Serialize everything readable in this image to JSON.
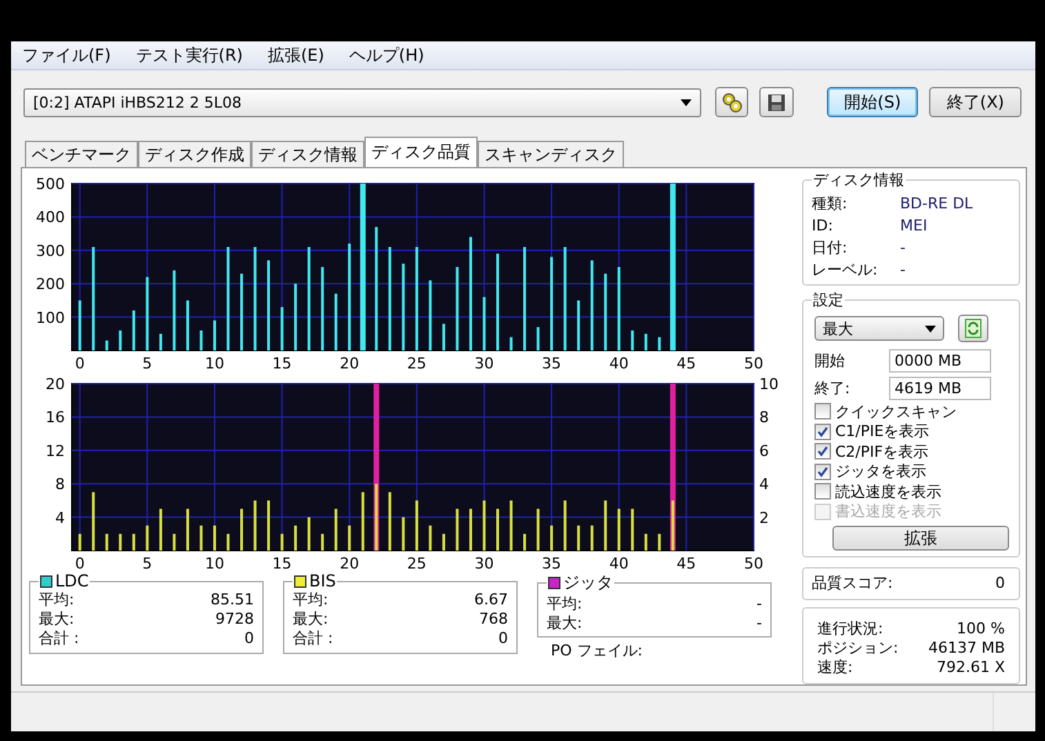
{
  "menu": [
    {
      "label": "ファイル(F)"
    },
    {
      "label": "テスト実行(R)"
    },
    {
      "label": "拡張(E)"
    },
    {
      "label": "ヘルプ(H)"
    }
  ],
  "toolbar": {
    "drive": "[0:2]   ATAPI iHBS212   2 5L08",
    "buttons": [
      {
        "label": "開始(S)",
        "focused": true
      },
      {
        "label": "終了(X)",
        "focused": false
      }
    ]
  },
  "tabs": [
    {
      "label": "ベンチマーク",
      "selected": false
    },
    {
      "label": "ディスク作成",
      "selected": false
    },
    {
      "label": "ディスク情報",
      "selected": false
    },
    {
      "label": "ディスク品質",
      "selected": true
    },
    {
      "label": "スキャンディスク",
      "selected": false
    }
  ],
  "charts": [
    {
      "chart_data": {
        "type": "bar",
        "grid": true,
        "xlim": [
          -0.6,
          50
        ],
        "ylim": [
          0,
          500
        ],
        "xticks": [
          0,
          5,
          10,
          15,
          20,
          25,
          30,
          35,
          40,
          45,
          50
        ],
        "yticks": [
          100,
          200,
          300,
          400,
          500
        ],
        "x": [
          0,
          1,
          2,
          3,
          4,
          5,
          6,
          7,
          8,
          9,
          10,
          11,
          12,
          13,
          14,
          15,
          16,
          17,
          18,
          19,
          20,
          21,
          22,
          23,
          24,
          25,
          26,
          27,
          28,
          29,
          30,
          31,
          32,
          33,
          34,
          35,
          36,
          37,
          38,
          39,
          40,
          41,
          42,
          43,
          44
        ],
        "series": [
          {
            "name": "LDC",
            "color": "#40e8f0",
            "values": [
              150,
              310,
              30,
              60,
              120,
              220,
              50,
              240,
              150,
              60,
              90,
              310,
              230,
              310,
              270,
              130,
              200,
              310,
              250,
              170,
              320,
              500,
              370,
              310,
              260,
              310,
              210,
              80,
              250,
              340,
              160,
              290,
              40,
              310,
              70,
              280,
              310,
              150,
              270,
              230,
              250,
              60,
              50,
              40,
              500
            ]
          }
        ]
      }
    },
    {
      "chart_data": {
        "type": "bar",
        "grid": true,
        "xlim": [
          -0.6,
          50
        ],
        "ylim": [
          0,
          20
        ],
        "y2lim": [
          0,
          10
        ],
        "xticks": [
          0,
          5,
          10,
          15,
          20,
          25,
          30,
          35,
          40,
          45,
          50
        ],
        "yticks": [
          4,
          8,
          12,
          16,
          20
        ],
        "y2ticks": [
          2,
          4,
          6,
          8,
          10
        ],
        "x": [
          0,
          1,
          2,
          3,
          4,
          5,
          6,
          7,
          8,
          9,
          10,
          11,
          12,
          13,
          14,
          15,
          16,
          17,
          18,
          19,
          20,
          21,
          22,
          23,
          24,
          25,
          26,
          27,
          28,
          29,
          30,
          31,
          32,
          33,
          34,
          35,
          36,
          37,
          38,
          39,
          40,
          41,
          42,
          43,
          44
        ],
        "series": [
          {
            "name": "BIS",
            "color": "#d8e040",
            "values": [
              2,
              7,
              2,
              2,
              2,
              3,
              5,
              2,
              5,
              3,
              3,
              2,
              5,
              6,
              6,
              2,
              3,
              4,
              2,
              5,
              3,
              7,
              8,
              7,
              4,
              6,
              3,
              2,
              5,
              5,
              6,
              5,
              6,
              2,
              5,
              3,
              6,
              3,
              3,
              6,
              5,
              5,
              2,
              2,
              6
            ]
          },
          {
            "name": "ジッタ",
            "color": "#e020a0",
            "values": [
              null,
              null,
              null,
              null,
              null,
              null,
              null,
              null,
              null,
              null,
              null,
              null,
              null,
              null,
              null,
              null,
              null,
              null,
              null,
              null,
              null,
              null,
              20,
              null,
              null,
              null,
              null,
              null,
              null,
              null,
              null,
              null,
              null,
              null,
              null,
              null,
              null,
              null,
              null,
              null,
              null,
              null,
              null,
              null,
              20
            ]
          }
        ]
      }
    }
  ],
  "stats": [
    {
      "color": "#33cccc",
      "rows": [
        {
          "label": "平均:",
          "value": "85.51"
        },
        {
          "label": "最大:",
          "value": "9728"
        },
        {
          "label": "合計 :",
          "value": "0"
        }
      ]
    },
    {
      "color": "#eeee33",
      "rows": [
        {
          "label": "平均:",
          "value": "6.67"
        },
        {
          "label": "最大:",
          "value": "768"
        },
        {
          "label": "合計 :",
          "value": "0"
        }
      ]
    },
    {
      "color": "#cc22cc",
      "rows": [
        {
          "label": "平均:",
          "value": "-"
        },
        {
          "label": "最大:",
          "value": "-"
        }
      ]
    }
  ],
  "po_fail": "PO フェイル:",
  "disc_info": {
    "title": "ディスク情報",
    "rows": [
      {
        "label": "種類:",
        "value": "BD-RE DL"
      },
      {
        "label": "ID:",
        "value": "MEI"
      },
      {
        "label": "日付:",
        "value": "-"
      },
      {
        "label": "レーベル:",
        "value": "-"
      }
    ]
  },
  "settings": {
    "title": "設定",
    "speed": "最大",
    "start": {
      "label": "開始",
      "value": "0000 MB"
    },
    "end": {
      "label": "終了:",
      "value": "4619 MB"
    },
    "options": [
      {
        "label": "クイックスキャン",
        "checked": false,
        "disabled": false
      },
      {
        "label": "C1/PIEを表示",
        "checked": true,
        "disabled": false
      },
      {
        "label": "C2/PIFを表示",
        "checked": true,
        "disabled": false
      },
      {
        "label": "ジッタを表示",
        "checked": true,
        "disabled": false
      },
      {
        "label": "読込速度を表示",
        "checked": false,
        "disabled": false
      },
      {
        "label": "書込速度を表示",
        "checked": false,
        "disabled": true
      }
    ],
    "button": "拡張"
  },
  "quality": {
    "label": "品質スコア:",
    "value": "0"
  },
  "progress": [
    {
      "label": "進行状況:",
      "value": "100 %"
    },
    {
      "label": "ポジション:",
      "value": "46137 MB"
    },
    {
      "label": "速度:",
      "value": "792.61 X"
    }
  ]
}
